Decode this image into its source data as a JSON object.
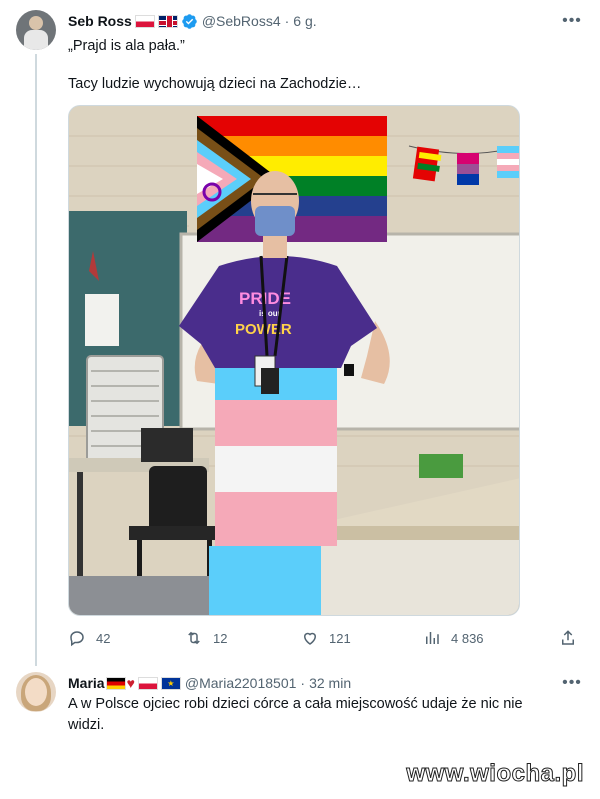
{
  "tweet": {
    "author_name": "Seb Ross",
    "handle": "@SebRoss4",
    "separator": "·",
    "time": "6 g.",
    "text_line1": "„Prajd is ala pała.”",
    "text_line2": "Tacy ludzie wychowują dzieci na Zachodzie…",
    "stats": {
      "replies": "42",
      "retweets": "12",
      "likes": "121",
      "views": "4 836"
    }
  },
  "reply": {
    "author_name": "Maria",
    "handle": "@Maria22018501",
    "separator": "·",
    "time": "32 min",
    "text_line1": "A w Polsce ojciec robi dzieci córce a cała miejscowość udaje że nic nie",
    "text_line2": "widzi."
  },
  "photo": {
    "shirt_text_1": "PRIDE",
    "shirt_text_2": "is our",
    "shirt_text_3": "POWER"
  },
  "watermark": "www.wiocha.pl",
  "colors": {
    "verified": "#1d9bf0",
    "text_secondary": "#536471",
    "divider": "#cfd9de"
  }
}
